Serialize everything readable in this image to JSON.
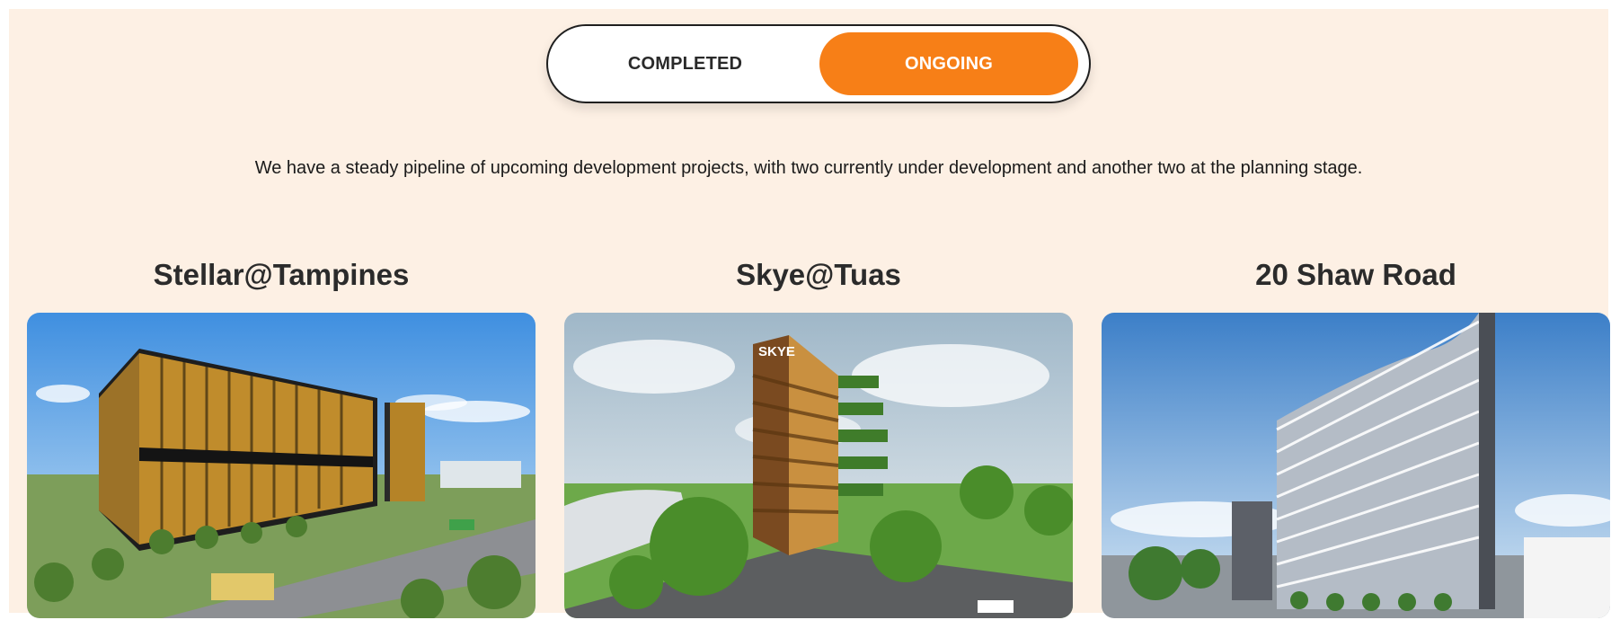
{
  "toggle": {
    "completed_label": "COMPLETED",
    "ongoing_label": "ONGOING",
    "active": "ongoing"
  },
  "intro": "We have a steady pipeline of upcoming development projects, with two currently under development and another two at the planning stage.",
  "projects": [
    {
      "title": "Stellar@Tampines"
    },
    {
      "title": "Skye@Tuas"
    },
    {
      "title": "20 Shaw Road"
    }
  ],
  "colors": {
    "accent": "#f77f17",
    "background": "#fdf0e4"
  }
}
